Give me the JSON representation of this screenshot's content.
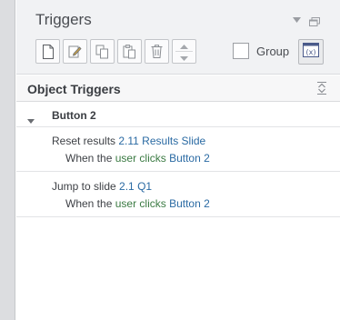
{
  "panel": {
    "title": "Triggers",
    "toolbar": {
      "new_icon": "new-document-icon",
      "edit_icon": "edit-icon",
      "copy_icon": "copy-icon",
      "paste_icon": "paste-icon",
      "delete_icon": "trash-icon",
      "group_label": "Group",
      "variables_icon": "variables-icon"
    }
  },
  "section": {
    "title": "Object Triggers"
  },
  "object": {
    "name": "Button 2"
  },
  "triggers": [
    {
      "action": "Reset results",
      "target": "2.11 Results Slide",
      "when": "When the",
      "who": "user clicks",
      "object": "Button 2"
    },
    {
      "action": "Jump to slide",
      "target": "2.1 Q1",
      "when": "When the",
      "who": "user clicks",
      "object": "Button 2"
    }
  ],
  "colors": {
    "link": "#2a6aa3",
    "condition": "#3a7a42",
    "header_bg": "#f1f2f4"
  }
}
